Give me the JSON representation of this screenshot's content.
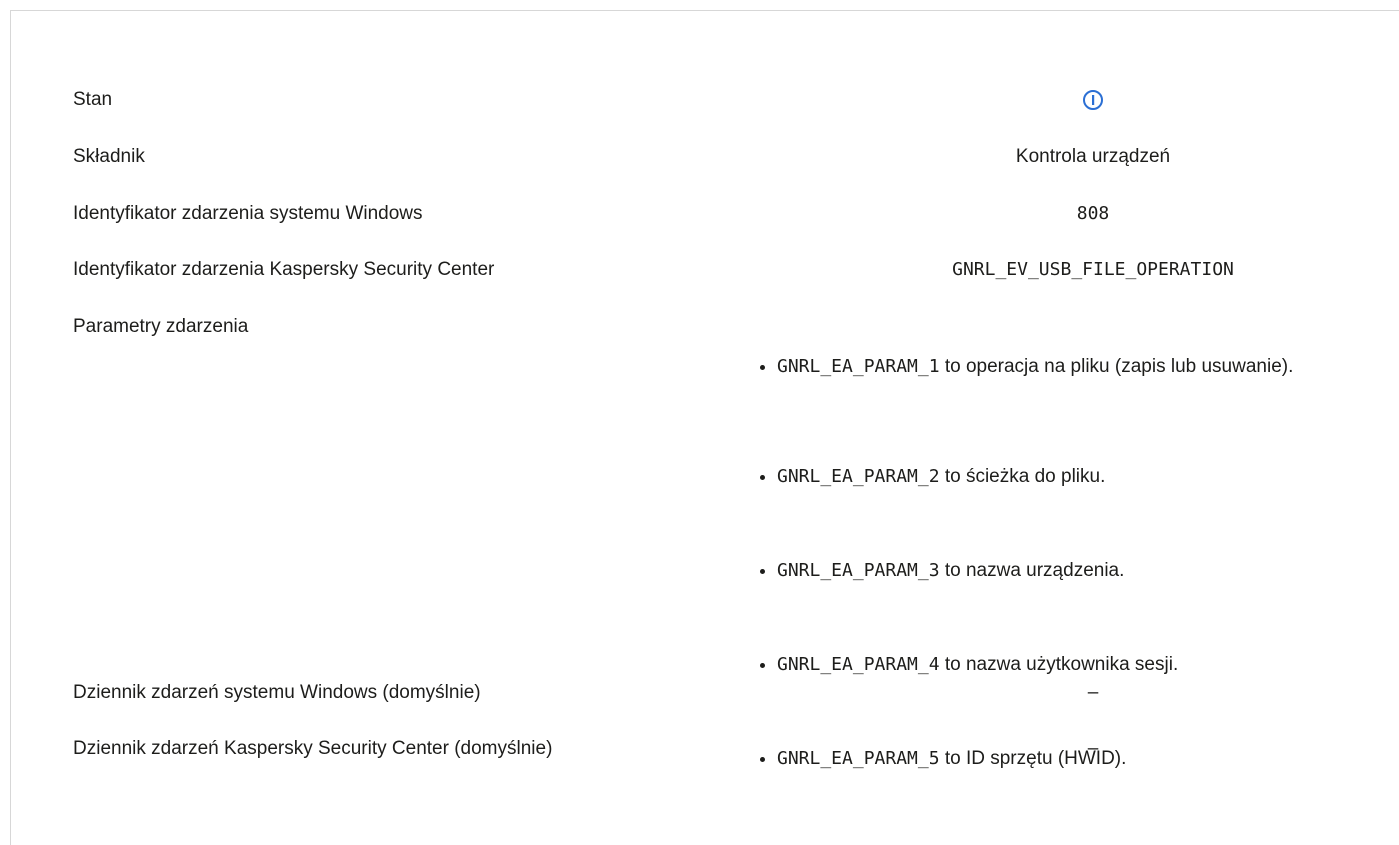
{
  "rows": {
    "status": {
      "label": "Stan",
      "icon": "info-icon",
      "icon_color": "#2b6fd4"
    },
    "component": {
      "label": "Składnik",
      "value": "Kontrola urządzeń"
    },
    "windows_event_id": {
      "label": "Identyfikator zdarzenia systemu Windows",
      "value": "808"
    },
    "ksc_event_id": {
      "label": "Identyfikator zdarzenia Kaspersky Security Center",
      "value": "GNRL_EV_USB_FILE_OPERATION"
    },
    "event_params": {
      "label": "Parametry zdarzenia",
      "items": [
        {
          "code": "GNRL_EA_PARAM_1",
          "text": " to operacja na pliku (zapis lub usuwanie)."
        },
        {
          "code": "GNRL_EA_PARAM_2",
          "text": " to ścieżka do pliku."
        },
        {
          "code": "GNRL_EA_PARAM_3",
          "text": " to nazwa urządzenia."
        },
        {
          "code": "GNRL_EA_PARAM_4",
          "text": " to nazwa użytkownika sesji."
        },
        {
          "code": "GNRL_EA_PARAM_5",
          "text": " to ID sprzętu (HWID)."
        }
      ]
    },
    "windows_log": {
      "label": "Dziennik zdarzeń systemu Windows (domyślnie)",
      "value": "–"
    },
    "ksc_log": {
      "label": "Dziennik zdarzeń Kaspersky Security Center (domyślnie)",
      "value": "–"
    }
  }
}
